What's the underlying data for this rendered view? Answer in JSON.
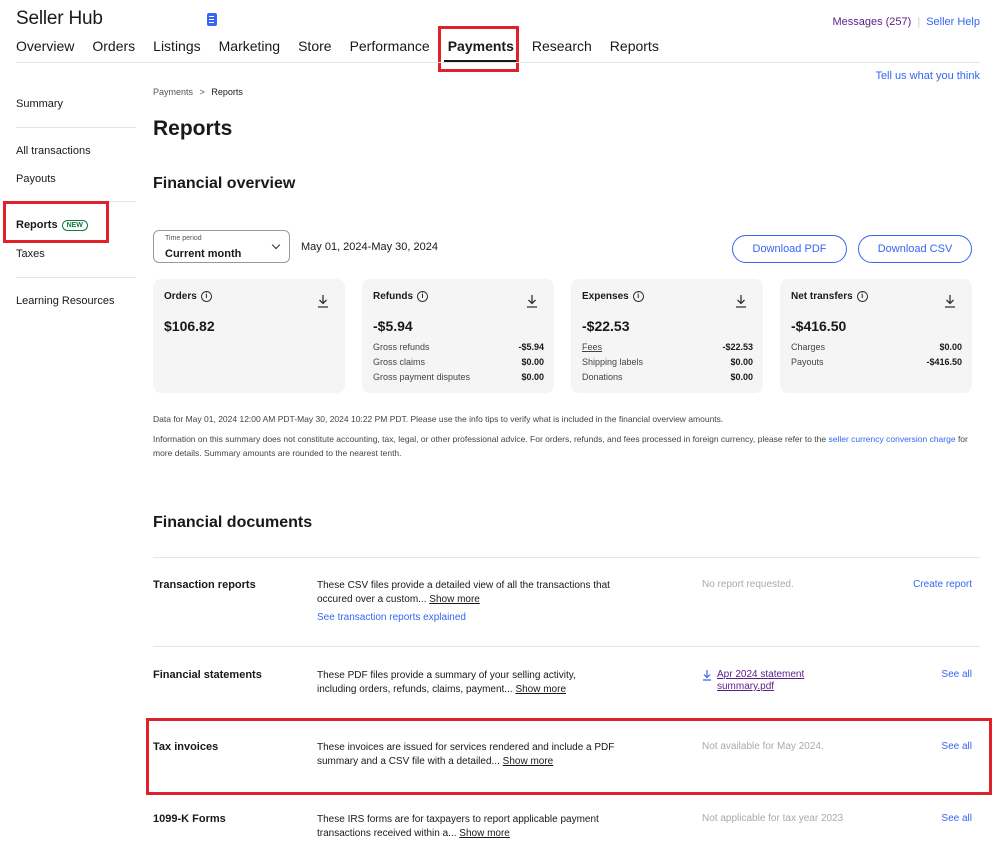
{
  "app": {
    "title": "Seller Hub"
  },
  "top_links": {
    "messages": "Messages (257)",
    "seller_help": "Seller Help"
  },
  "nav": [
    {
      "label": "Overview"
    },
    {
      "label": "Orders"
    },
    {
      "label": "Listings"
    },
    {
      "label": "Marketing"
    },
    {
      "label": "Store"
    },
    {
      "label": "Performance"
    },
    {
      "label": "Payments"
    },
    {
      "label": "Research"
    },
    {
      "label": "Reports"
    }
  ],
  "feedback_link": "Tell us what you think",
  "sidebar": {
    "summary": "Summary",
    "all_transactions": "All transactions",
    "payouts": "Payouts",
    "reports": "Reports",
    "reports_badge": "NEW",
    "taxes": "Taxes",
    "learning": "Learning Resources"
  },
  "breadcrumb": {
    "parent": "Payments",
    "separator": ">",
    "current": "Reports"
  },
  "page_title": "Reports",
  "overview": {
    "heading": "Financial overview",
    "time_period_label": "Time period",
    "time_period_value": "Current month",
    "date_range": "May 01, 2024-May 30, 2024",
    "download_pdf": "Download PDF",
    "download_csv": "Download CSV",
    "cards": [
      {
        "title": "Orders",
        "amount": "$106.82",
        "rows": []
      },
      {
        "title": "Refunds",
        "amount": "-$5.94",
        "rows": [
          {
            "label": "Gross refunds",
            "value": "-$5.94"
          },
          {
            "label": "Gross claims",
            "value": "$0.00"
          },
          {
            "label": "Gross payment disputes",
            "value": "$0.00"
          }
        ]
      },
      {
        "title": "Expenses",
        "amount": "-$22.53",
        "rows": [
          {
            "label": "Fees",
            "value": "-$22.53"
          },
          {
            "label": "Shipping labels",
            "value": "$0.00"
          },
          {
            "label": "Donations",
            "value": "$0.00"
          }
        ]
      },
      {
        "title": "Net transfers",
        "amount": "-$416.50",
        "rows": [
          {
            "label": "Charges",
            "value": "$0.00"
          },
          {
            "label": "Payouts",
            "value": "-$416.50"
          }
        ]
      }
    ],
    "note1": "Data for May 01, 2024 12:00 AM PDT-May 30, 2024 10:22 PM PDT. Please use the info tips to verify what is included in the financial overview amounts.",
    "note2_a": "Information on this summary does not constitute accounting, tax, legal, or other professional advice. For orders, refunds, and fees processed in foreign currency, please refer to the ",
    "note2_link": "seller currency conversion charge",
    "note2_b": " for more details. Summary amounts are rounded to the nearest tenth."
  },
  "documents": {
    "heading": "Financial documents",
    "items": [
      {
        "title": "Transaction reports",
        "desc": "These CSV files provide a detailed view of all the transactions that occured over a custom...",
        "more": "Show more",
        "extra_link": "See transaction reports explained",
        "status": "No report requested.",
        "action": "Create report"
      },
      {
        "title": "Financial statements",
        "desc": "These PDF files provide a summary of your selling activity, including orders, refunds, claims, payment...",
        "more": "Show more",
        "file": "Apr 2024 statement summary.pdf",
        "action": "See all"
      },
      {
        "title": "Tax invoices",
        "desc": "These invoices are issued for services rendered and include a PDF summary and a CSV file with a detailed...",
        "more": "Show more",
        "status": "Not available for May 2024.",
        "action": "See all"
      },
      {
        "title": "1099-K Forms",
        "desc": "These IRS forms are for taxpayers to report applicable payment transactions received within a...",
        "more": "Show more",
        "status": "Not applicable for tax year 2023",
        "action": "See all"
      }
    ]
  },
  "colors": {
    "link": "#3665f3",
    "highlight": "#e0202a",
    "visited": "#5b1d8a",
    "card_bg": "#f5f5f5"
  }
}
